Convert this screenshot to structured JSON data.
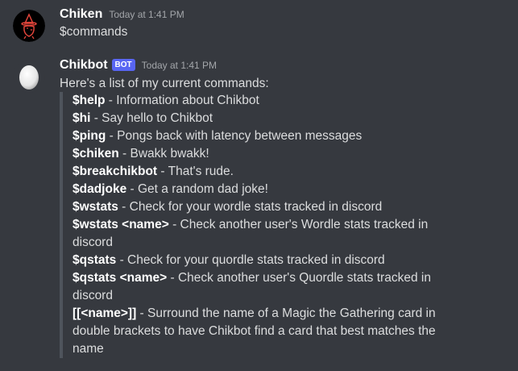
{
  "messages": [
    {
      "username": "Chiken",
      "timestamp": "Today at 1:41 PM",
      "avatar_icon": "witch-chicken-avatar",
      "text": "$commands"
    },
    {
      "username": "Chikbot",
      "badge": "BOT",
      "timestamp": "Today at 1:41 PM",
      "avatar_icon": "egg-avatar",
      "text": "Here's a list of my current commands:",
      "commands": [
        {
          "cmd": "$help",
          "desc": " - Information about Chikbot"
        },
        {
          "cmd": "$hi",
          "desc": " - Say hello to Chikbot"
        },
        {
          "cmd": "$ping",
          "desc": " - Pongs back with latency between messages"
        },
        {
          "cmd": "$chiken",
          "desc": " - Bwakk bwakk!"
        },
        {
          "cmd": "$breakchikbot",
          "desc": " - That's rude."
        },
        {
          "cmd": "$dadjoke",
          "desc": " - Get a random dad joke!"
        },
        {
          "cmd": "$wstats",
          "desc": " - Check for your wordle stats tracked in discord"
        },
        {
          "cmd": "$wstats <name>",
          "desc": " - Check another user's Wordle stats tracked in discord"
        },
        {
          "cmd": "$qstats",
          "desc": " - Check for your quordle stats tracked in discord"
        },
        {
          "cmd": "$qstats <name>",
          "desc": " - Check another user's Quordle stats tracked in discord"
        },
        {
          "cmd": "[[<name>]]",
          "desc": " - Surround the name of a Magic the Gathering card in double brackets to have Chikbot find a card that best matches the name"
        }
      ]
    }
  ],
  "colors": {
    "background": "#36393f",
    "text": "#dcddde",
    "username": "#ffffff",
    "timestamp": "#a3a6aa",
    "bot_badge": "#5865f2",
    "quote_bar": "#4f545c"
  }
}
